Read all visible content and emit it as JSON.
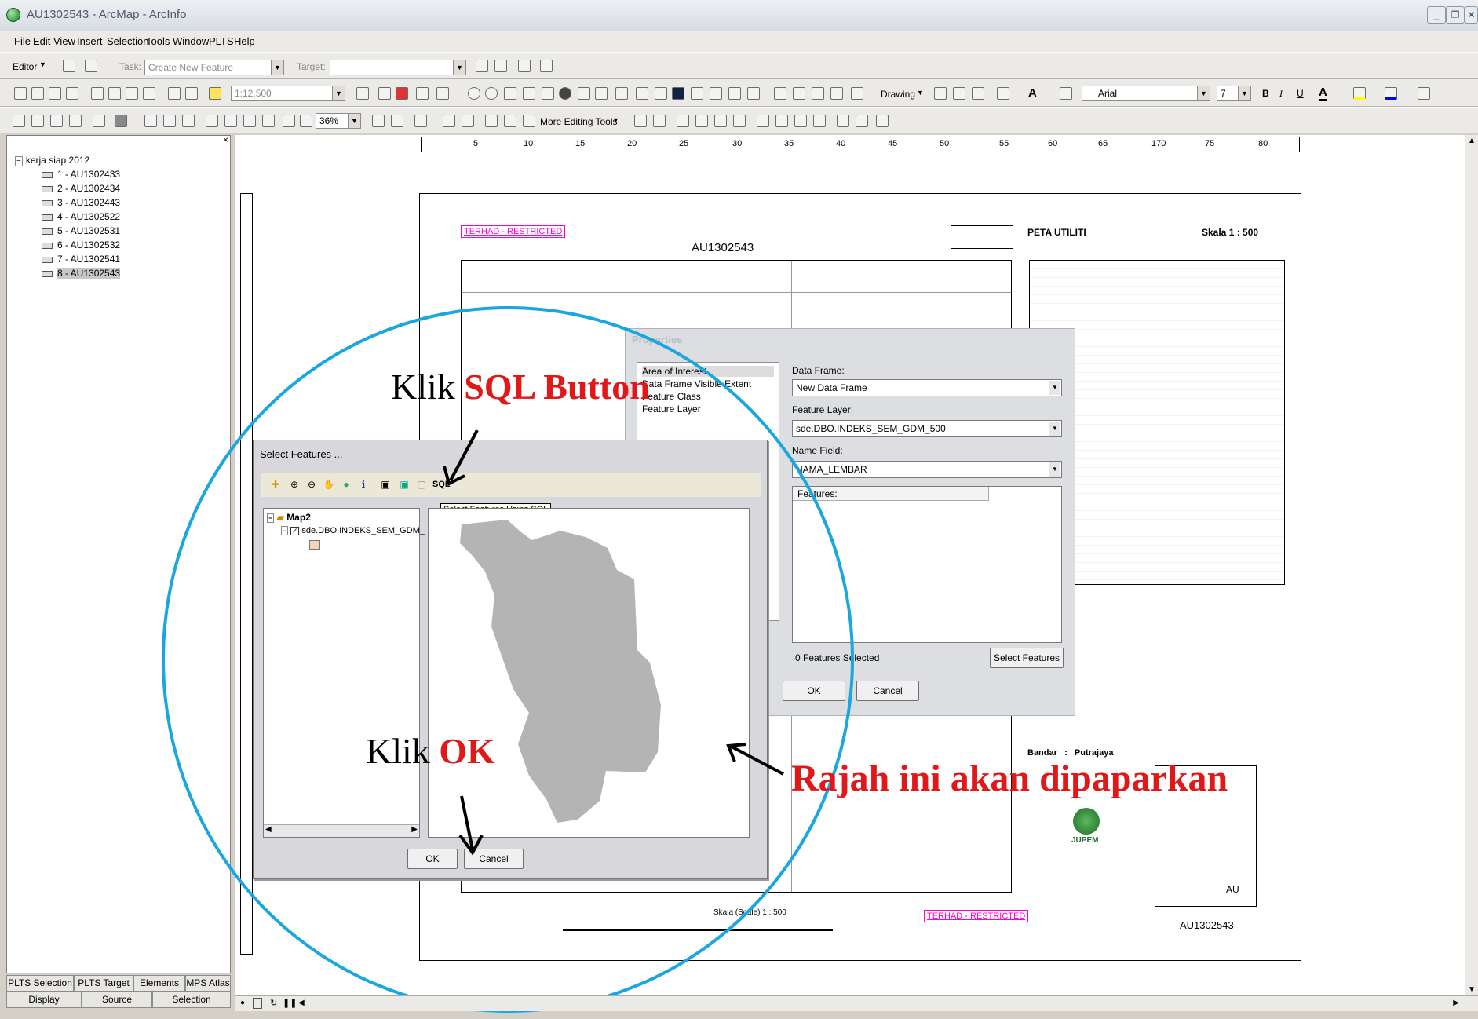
{
  "window": {
    "title": "AU1302543 - ArcMap - ArcInfo"
  },
  "menu": [
    "File",
    "Edit",
    "View",
    "Insert",
    "Selection",
    "Tools",
    "Window",
    "PLTS",
    "Help"
  ],
  "editor_toolbar": {
    "editor_label": "Editor",
    "task_label": "Task:",
    "task_value": "Create New Feature",
    "target_label": "Target:",
    "target_value": ""
  },
  "standard_toolbar": {
    "scale_value": "1:12,500",
    "drawing_label": "Drawing",
    "font_value": "Arial",
    "font_size": "7",
    "bold": "B",
    "italic": "I",
    "underline": "U"
  },
  "layout_toolbar": {
    "zoom_value": "36%",
    "more_editing_tools": "More Editing Tools"
  },
  "toc": {
    "root": "kerja siap 2012",
    "items": [
      "1 - AU1302433",
      "2 - AU1302434",
      "3 - AU1302443",
      "4 - AU1302522",
      "5 - AU1302531",
      "6 - AU1302532",
      "7 - AU1302541",
      "8 - AU1302543"
    ],
    "tabs_top": [
      "PLTS Selection",
      "PLTS Target",
      "Elements",
      "MPS Atlas"
    ],
    "tabs_bottom": [
      "Display",
      "Source",
      "Selection"
    ]
  },
  "ruler": {
    "ticks": [
      "5",
      "10",
      "15",
      "20",
      "25",
      "30",
      "35",
      "40",
      "45",
      "50",
      "55",
      "60",
      "65",
      "170",
      "75",
      "80"
    ]
  },
  "page": {
    "restricted_top": "TERHAD - RESTRICTED",
    "restricted_bottom": "TERHAD - RESTRICTED",
    "sheet_top": "AU1302543",
    "sheet_bottom": "AU1302543",
    "util_title": "PETA UTILITI",
    "scale_title": "Skala 1 : 500",
    "bandar_label": "Bandar",
    "bandar_sep": ":",
    "bandar_value": "Putrajaya",
    "scale_bottom": "Skala  (Scale)  1 : 500",
    "logo_text": "JUPEM",
    "corner_text": "AU"
  },
  "properties_dialog": {
    "title": "Properties",
    "list_items": [
      "Area of Interest",
      "Data Frame Visible Extent",
      "Feature Class",
      "Feature Layer"
    ],
    "data_frame_label": "Data Frame:",
    "data_frame_value": "New Data Frame",
    "feature_layer_label": "Feature Layer:",
    "feature_layer_value": "sde.DBO.INDEKS_SEM_GDM_500",
    "name_field_label": "Name Field:",
    "name_field_value": "NAMA_LEMBAR",
    "features_header": "Features:",
    "selected_count": "0 Features Selected",
    "select_features_btn": "Select Features",
    "ok": "OK",
    "cancel": "Cancel"
  },
  "select_dialog": {
    "title": "Select Features ...",
    "sql_label": "SQL",
    "tooltip": "Select Features Using SQL",
    "map_name": "Map2",
    "layer_name": "sde.DBO.INDEKS_SEM_GDM_",
    "ok": "OK",
    "cancel": "Cancel"
  },
  "annotations": {
    "klik_sql_prefix": "Klik ",
    "klik_sql_emph": "SQL Button",
    "klik_ok_prefix": "Klik ",
    "klik_ok_emph": "OK",
    "rajah": "Rajah ini akan dipaparkan"
  },
  "colors": {
    "annotation_red": "#e01818",
    "circle_blue": "#1aa6df",
    "restricted_magenta": "#ff00cc",
    "map_gray": "#b4b4b4"
  }
}
